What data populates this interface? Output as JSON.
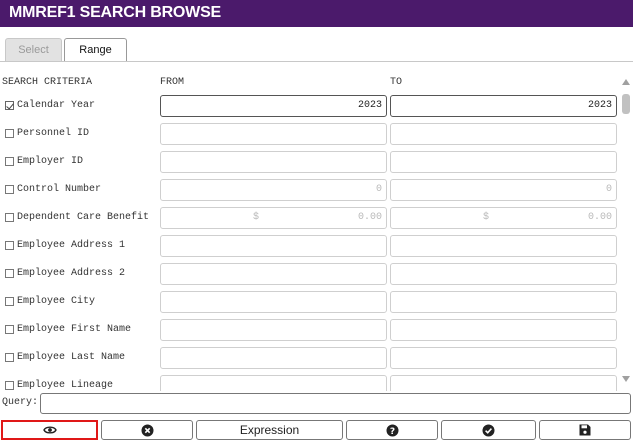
{
  "window": {
    "title": "MMREF1 SEARCH BROWSE"
  },
  "tabs": [
    {
      "label": "Select",
      "active": false
    },
    {
      "label": "Range",
      "active": true
    }
  ],
  "headers": {
    "criteria": "SEARCH CRITERIA",
    "from": "FROM",
    "to": "TO"
  },
  "rows": [
    {
      "label": "Calendar Year",
      "checked": true,
      "from": "2023",
      "to": "2023"
    },
    {
      "label": "Personnel ID",
      "checked": false,
      "from": "",
      "to": ""
    },
    {
      "label": "Employer ID",
      "checked": false,
      "from": "",
      "to": ""
    },
    {
      "label": "Control Number",
      "checked": false,
      "from": "0",
      "to": "0"
    },
    {
      "label": "Dependent Care Benefit",
      "checked": false,
      "from_currency": "$",
      "from": "0.00",
      "to_currency": "$",
      "to": "0.00"
    },
    {
      "label": "Employee Address 1",
      "checked": false,
      "from": "",
      "to": ""
    },
    {
      "label": "Employee Address 2",
      "checked": false,
      "from": "",
      "to": ""
    },
    {
      "label": "Employee City",
      "checked": false,
      "from": "",
      "to": ""
    },
    {
      "label": "Employee First Name",
      "checked": false,
      "from": "",
      "to": ""
    },
    {
      "label": "Employee Last Name",
      "checked": false,
      "from": "",
      "to": ""
    },
    {
      "label": "Employee Lineage",
      "checked": false,
      "from": "",
      "to": ""
    }
  ],
  "query": {
    "label": "Query:",
    "value": ""
  },
  "buttons": {
    "view_icon": "eye-icon",
    "clear_icon": "circle-x-icon",
    "expression_label": "Expression",
    "help_icon": "question-circle-icon",
    "ok_icon": "check-circle-icon",
    "save_icon": "floppy-disk-icon"
  },
  "colors": {
    "titlebar": "#4b1a6b",
    "highlight": "#e01818"
  }
}
